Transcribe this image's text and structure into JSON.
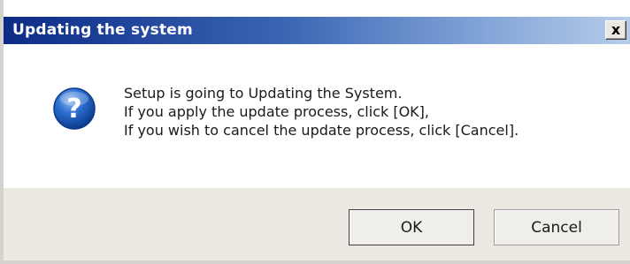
{
  "window": {
    "title": "Updating the system",
    "close_label": "x"
  },
  "message": {
    "line1": "Setup is going to Updating the System.",
    "line2": "If you apply the update process, click [OK],",
    "line3": "If you wish to cancel the update process, click [Cancel]."
  },
  "buttons": {
    "ok_label": "OK",
    "cancel_label": "Cancel"
  },
  "icon": {
    "name": "question-icon",
    "color": "#1f5fbf"
  }
}
